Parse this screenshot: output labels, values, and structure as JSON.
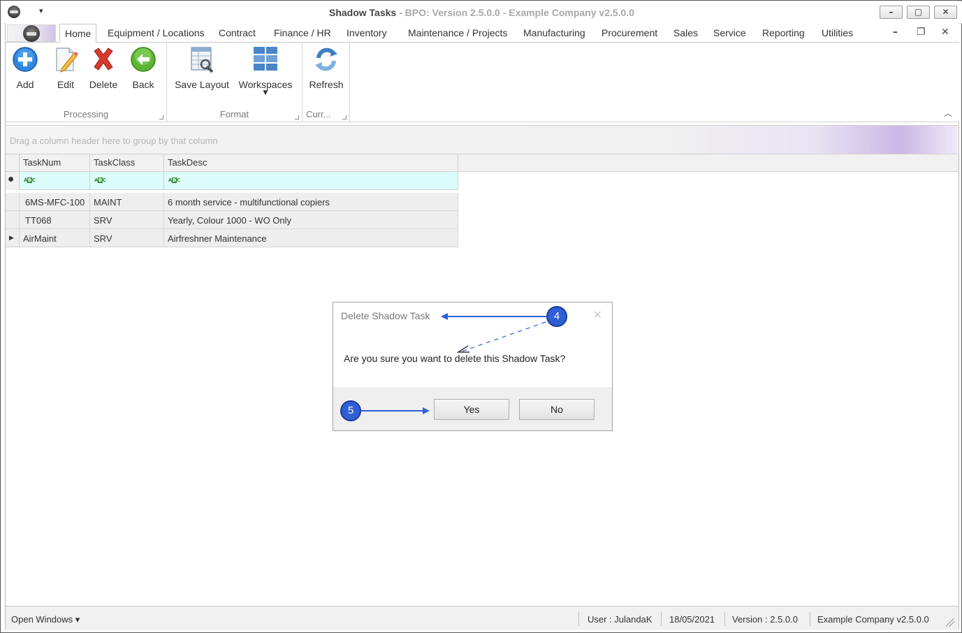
{
  "window": {
    "title_main": "Shadow Tasks",
    "title_sub": "- BPO: Version 2.5.0.0 - Example Company v2.5.0.0",
    "qa_dropdown": "▾",
    "minimize": "–",
    "maximize": "▢",
    "close": "✕",
    "mdi_minimize": "–",
    "mdi_restore": "❐",
    "mdi_close": "✕"
  },
  "tabs": [
    {
      "label": "Home"
    },
    {
      "label": "Equipment / Locations"
    },
    {
      "label": "Contract"
    },
    {
      "label": "Finance / HR"
    },
    {
      "label": "Inventory"
    },
    {
      "label": "Maintenance / Projects"
    },
    {
      "label": "Manufacturing"
    },
    {
      "label": "Procurement"
    },
    {
      "label": "Sales"
    },
    {
      "label": "Service"
    },
    {
      "label": "Reporting"
    },
    {
      "label": "Utilities"
    }
  ],
  "ribbon": {
    "groups": {
      "processing": "Processing",
      "format": "Format",
      "currency": "Curr..."
    },
    "buttons": {
      "add": "Add",
      "edit": "Edit",
      "delete": "Delete",
      "back": "Back",
      "save_layout": "Save Layout",
      "workspaces": "Workspaces",
      "refresh": "Refresh"
    },
    "colors": {
      "add": "#2e86de",
      "delete": "#d63a2f",
      "back": "#5cb531"
    }
  },
  "group_panel": {
    "text": "Drag a column header here to group by that column"
  },
  "grid": {
    "columns": [
      "TaskNum",
      "TaskClass",
      "TaskDesc"
    ],
    "rows": [
      {
        "tasknum": "6MS-MFC-100",
        "taskclass": "MAINT",
        "taskdesc": "6 month service - multifunctional copiers"
      },
      {
        "tasknum": "TT068",
        "taskclass": "SRV",
        "taskdesc": "Yearly, Colour 1000 - WO Only"
      },
      {
        "tasknum": "AirMaint",
        "taskclass": "SRV",
        "taskdesc": "Airfreshner Maintenance"
      }
    ]
  },
  "dialog": {
    "title": "Delete Shadow Task",
    "message": "Are you sure you want to delete this Shadow Task?",
    "yes": "Yes",
    "no": "No",
    "close": "✕"
  },
  "annotations": {
    "step4": "4",
    "step5": "5",
    "color": "#2f5fd6"
  },
  "statusbar": {
    "open_windows": "Open Windows ▾",
    "user": "User : JulandaK",
    "date": "18/05/2021",
    "version": "Version : 2.5.0.0",
    "company": "Example Company v2.5.0.0"
  }
}
